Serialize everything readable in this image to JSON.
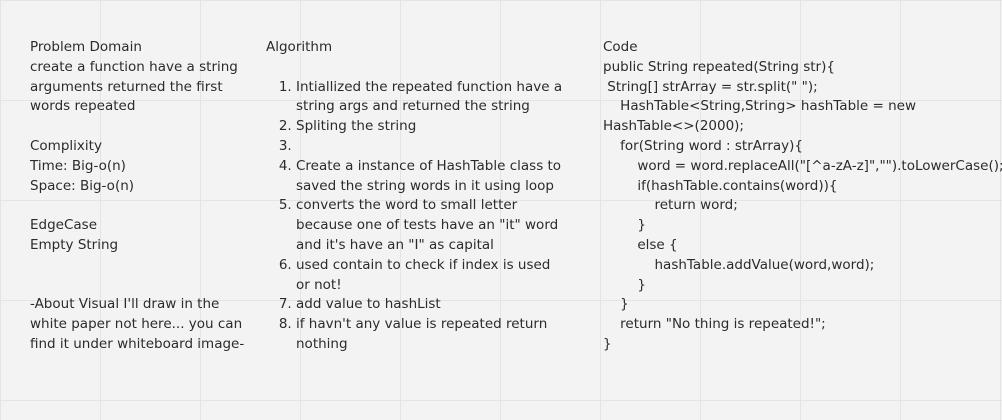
{
  "problem": {
    "heading": "Problem Domain",
    "description": "create a function have a string arguments returned the first words repeated",
    "complexity_heading": "Complixity",
    "time": "Time: Big-o(n)",
    "space": "Space: Big-o(n)",
    "edgecase_heading": "EdgeCase",
    "edgecase": "Empty String",
    "visual_note": "-About Visual I'll draw in the white paper not here... you can find it under whiteboard image-"
  },
  "algorithm": {
    "heading": "Algorithm",
    "steps": [
      "Intiallized the repeated function have a string args and returned the string",
      "Spliting the string",
      "",
      "Create a instance of HashTable class to saved the string words in it using loop",
      "converts the word to small letter because one of tests have an \"it\" word and it's have an \"I\" as capital",
      "used contain to check if index is used or not!",
      "add value to hashList",
      "if havn't any value is repeated return nothing"
    ]
  },
  "code": {
    "heading": "Code",
    "lines": [
      "public String repeated(String str){",
      " String[] strArray = str.split(\" \");",
      "    HashTable<String,String> hashTable = new",
      "HashTable<>(2000);",
      "    for(String word : strArray){",
      "        word = word.replaceAll(\"[^a-zA-z]\",\"\").toLowerCase();",
      "        if(hashTable.contains(word)){",
      "            return word;",
      "        }",
      "        else {",
      "            hashTable.addValue(word,word);",
      "        }",
      "    }",
      "    return \"No thing is repeated!\";",
      "}"
    ]
  }
}
